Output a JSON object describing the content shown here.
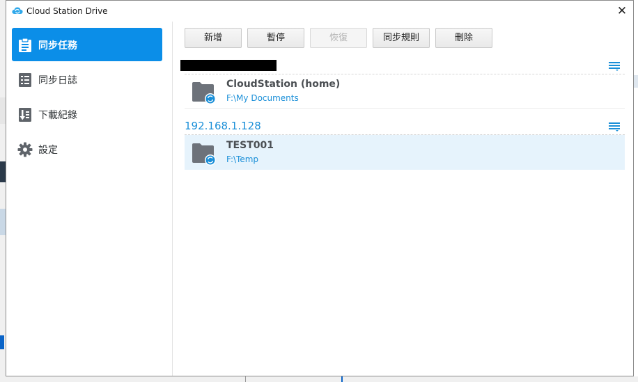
{
  "window": {
    "title": "Cloud Station Drive"
  },
  "sidebar": {
    "items": [
      {
        "label": "同步任務",
        "icon": "task-list-icon",
        "active": true
      },
      {
        "label": "同步日誌",
        "icon": "log-list-icon",
        "active": false
      },
      {
        "label": "下載紀錄",
        "icon": "download-history-icon",
        "active": false
      },
      {
        "label": "設定",
        "icon": "gear-icon",
        "active": false
      }
    ]
  },
  "toolbar": {
    "buttons": [
      {
        "label": "新增",
        "enabled": true
      },
      {
        "label": "暫停",
        "enabled": true
      },
      {
        "label": "恢復",
        "enabled": false
      },
      {
        "label": "同步規則",
        "enabled": true
      },
      {
        "label": "刪除",
        "enabled": true
      }
    ]
  },
  "groups": [
    {
      "title": "",
      "tasks": [
        {
          "name": "CloudStation (home)",
          "path": "F:\\My Documents",
          "selected": false
        }
      ]
    },
    {
      "title": "192.168.1.128",
      "tasks": [
        {
          "name": "TEST001",
          "path": "F:\\Temp",
          "selected": true
        }
      ]
    }
  ],
  "colors": {
    "accent": "#0b8ee8",
    "link": "#1a8fd8",
    "folder": "#6d727a",
    "selected_row": "#e6f3fc"
  }
}
